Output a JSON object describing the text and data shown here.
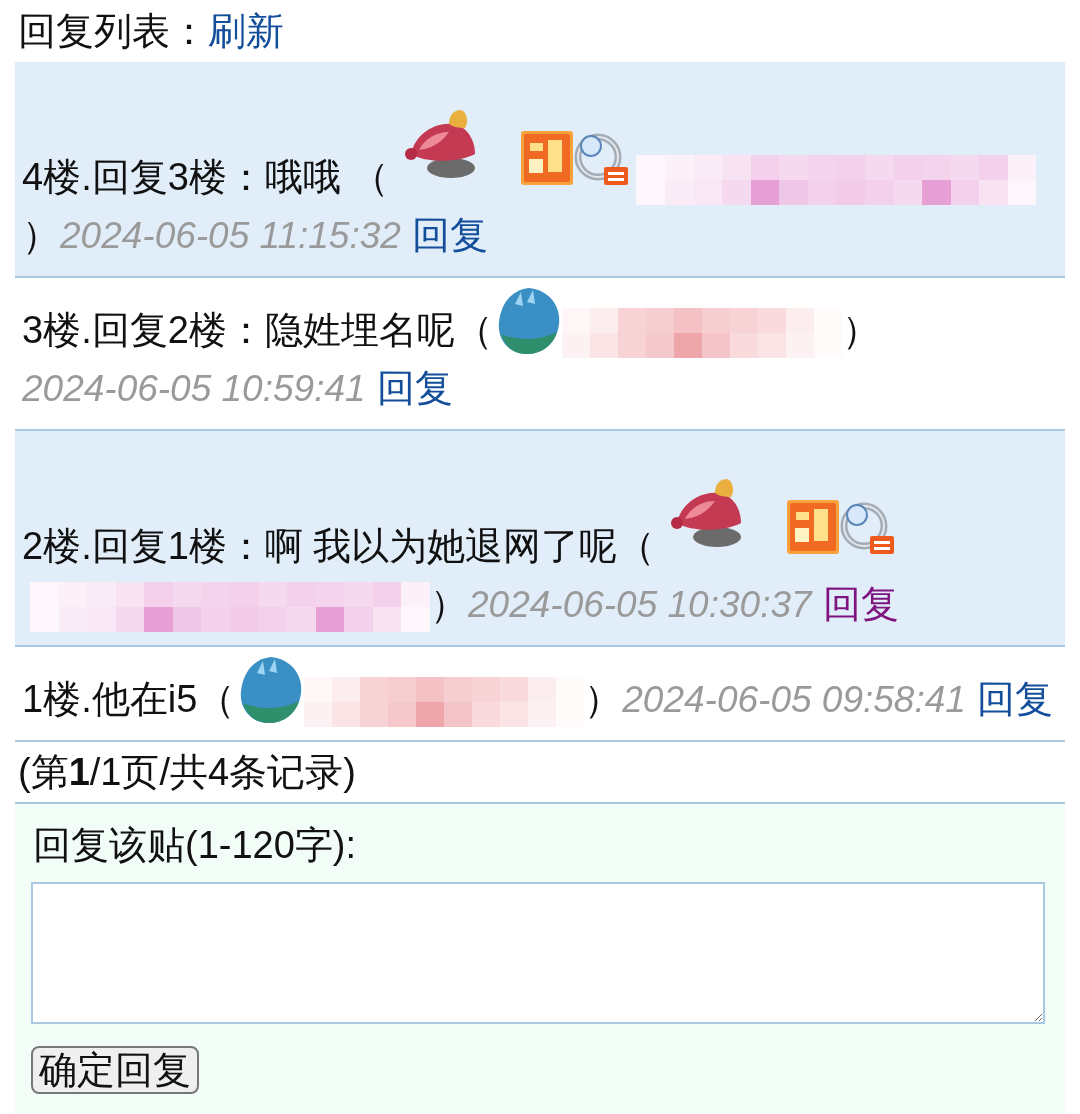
{
  "header": {
    "title": "回复列表：",
    "refresh_link": "刷新"
  },
  "replies": [
    {
      "text": "4楼.回复3楼：哦哦 （",
      "author": {
        "kind": "vip",
        "color": "#e6a0d6"
      },
      "close": "）",
      "time": "2024-06-05 11:15:32",
      "reply_link": {
        "label": "回复",
        "visited": false
      }
    },
    {
      "text": "3楼.回复2楼：隐姓埋名呢（",
      "author": {
        "kind": "member",
        "color": "#efa6ab"
      },
      "close": "）",
      "time": "2024-06-05 10:59:41",
      "reply_link": {
        "label": "回复",
        "visited": false
      }
    },
    {
      "text": "2楼.回复1楼：啊 我以为她退网了呢（",
      "author": {
        "kind": "vip",
        "color": "#e6a0d6"
      },
      "close": "）",
      "time": "2024-06-05 10:30:37",
      "reply_link": {
        "label": "回复",
        "visited": true
      }
    },
    {
      "text": "1楼.他在i5（",
      "author": {
        "kind": "member",
        "color": "#efa6ab"
      },
      "close": "）",
      "time": "2024-06-05 09:58:41",
      "reply_link": {
        "label": "回复",
        "visited": false
      }
    }
  ],
  "pagination": "(第**1**/1页/共4条记录)",
  "reply_form": {
    "label": "回复该贴(1-120字):",
    "submit": "确定回复"
  }
}
